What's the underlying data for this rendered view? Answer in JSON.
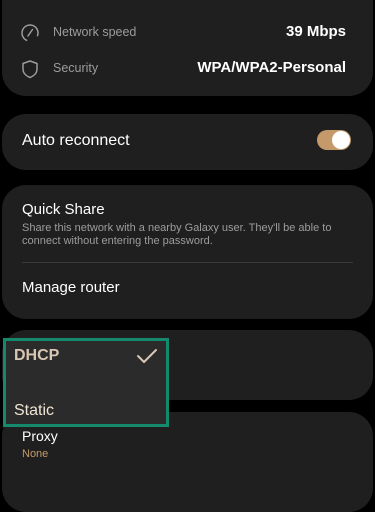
{
  "network_info": {
    "speed": {
      "label": "Network speed",
      "value": "39 Mbps",
      "icon": "network-speed-icon"
    },
    "security": {
      "label": "Security",
      "value": "WPA/WPA2-Personal",
      "icon": "shield-icon"
    }
  },
  "auto_reconnect": {
    "label": "Auto reconnect",
    "enabled": true
  },
  "quick_share": {
    "title": "Quick Share",
    "description": "Share this network with a nearby Galaxy user. They'll be able to connect without entering the password."
  },
  "manage_router": {
    "label": "Manage router"
  },
  "ip_settings_popup": {
    "options": [
      {
        "label": "DHCP",
        "selected": true
      },
      {
        "label": "Static",
        "selected": false
      }
    ]
  },
  "proxy": {
    "label": "Proxy",
    "value": "None"
  },
  "colors": {
    "background": "#000000",
    "card": "#1f1f1f",
    "accent": "#c59a6a",
    "highlight_border": "#138a6b",
    "secondary_text": "#9c9c9c"
  }
}
